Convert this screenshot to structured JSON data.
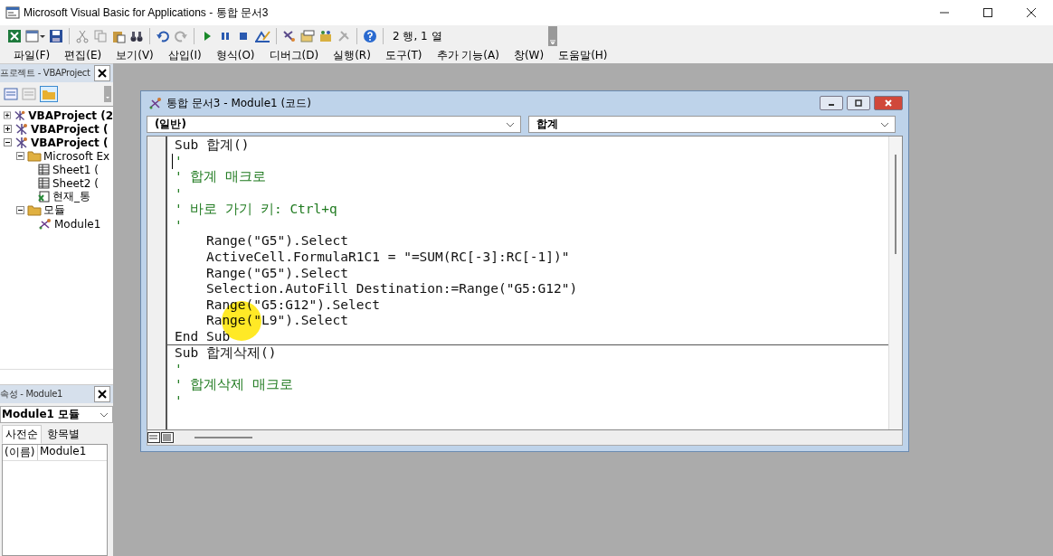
{
  "window": {
    "title": "Microsoft Visual Basic for Applications - 통합 문서3"
  },
  "toolbar": {
    "position": "2 행, 1 열"
  },
  "menu": [
    "파일(F)",
    "편집(E)",
    "보기(V)",
    "삽입(I)",
    "형식(O)",
    "디버그(D)",
    "실행(R)",
    "도구(T)",
    "추가 기능(A)",
    "창(W)",
    "도움말(H)"
  ],
  "project_explorer": {
    "title": "프로젝트 - VBAProject",
    "tree": [
      {
        "label": "VBAProject (2",
        "kind": "project",
        "expanded": false
      },
      {
        "label": "VBAProject (",
        "kind": "project",
        "expanded": false
      },
      {
        "label": "VBAProject (",
        "kind": "project",
        "expanded": true,
        "children": [
          {
            "label": "Microsoft Ex",
            "kind": "folder",
            "expanded": true,
            "children": [
              {
                "label": "Sheet1 (",
                "kind": "sheet"
              },
              {
                "label": "Sheet2 (",
                "kind": "sheet"
              },
              {
                "label": "현재_통",
                "kind": "workbook"
              }
            ]
          },
          {
            "label": "모듈",
            "kind": "folder",
            "expanded": true,
            "children": [
              {
                "label": "Module1",
                "kind": "module"
              }
            ]
          }
        ]
      }
    ]
  },
  "properties": {
    "title": "속성 - Module1",
    "object": "Module1 모듈",
    "tabs": [
      {
        "label": "사전순",
        "selected": true
      },
      {
        "label": "항목별",
        "selected": false
      }
    ],
    "rows": [
      {
        "name": "(이름)",
        "value": "Module1"
      }
    ]
  },
  "code_window": {
    "title": "통합 문서3 - Module1 (코드)",
    "object_list": "(일반)",
    "procedure_list": "합계",
    "procedures": [
      {
        "lines": [
          {
            "kind": "code",
            "text": "Sub 합계()"
          },
          {
            "kind": "comment",
            "text": "'"
          },
          {
            "kind": "comment",
            "text": "' 합계 매크로"
          },
          {
            "kind": "comment",
            "text": "'"
          },
          {
            "kind": "comment",
            "text": "' 바로 가기 키: Ctrl+q"
          },
          {
            "kind": "comment",
            "text": "'"
          },
          {
            "kind": "code",
            "text": "    Range(\"G5\").Select"
          },
          {
            "kind": "code",
            "text": "    ActiveCell.FormulaR1C1 = \"=SUM(RC[-3]:RC[-1])\""
          },
          {
            "kind": "code",
            "text": "    Range(\"G5\").Select"
          },
          {
            "kind": "code",
            "text": "    Selection.AutoFill Destination:=Range(\"G5:G12\")"
          },
          {
            "kind": "code",
            "text": "    Range(\"G5:G12\").Select"
          },
          {
            "kind": "code",
            "text": "    Range(\"L9\").Select"
          },
          {
            "kind": "code",
            "text": "End Sub"
          }
        ]
      },
      {
        "lines": [
          {
            "kind": "code",
            "text": "Sub 합계삭제()"
          },
          {
            "kind": "comment",
            "text": "'"
          },
          {
            "kind": "comment",
            "text": "' 합계삭제 매크로"
          },
          {
            "kind": "comment",
            "text": "'"
          }
        ]
      }
    ]
  }
}
